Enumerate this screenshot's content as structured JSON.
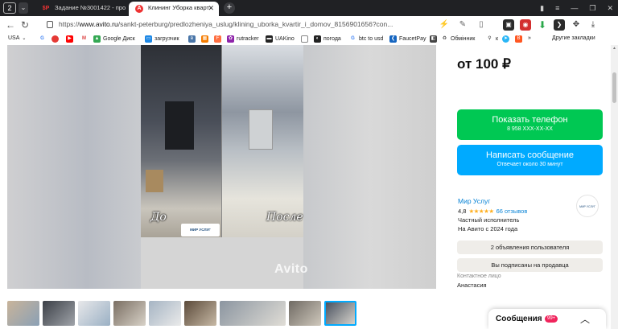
{
  "browser": {
    "tab_count": "2",
    "tabs": [
      {
        "label": "Задание №3001422 - про",
        "favicon": "$P"
      },
      {
        "label": "Клининг Уборка кварт",
        "favicon": "A"
      }
    ],
    "url_prefix": "https://",
    "url_host": "www.avito.ru",
    "url_path": "/sankt-peterburg/predlozheniya_uslug/klining_uborka_kvartir_i_domov_8156901656?con..."
  },
  "bookmarks": {
    "items": [
      "USA",
      "Google Диск",
      "загрузчик",
      "rutracker",
      "UAKino",
      "погода",
      "btc to usd",
      "FaucetPay",
      "Обмінник",
      "к"
    ],
    "other": "Другие закладки"
  },
  "gallery": {
    "label_before": "До",
    "label_after": "После",
    "logo_text": "МИР УСЛУГ",
    "watermark": "Avito"
  },
  "listing": {
    "price": "от 100 ₽",
    "phone_button": {
      "title": "Показать телефон",
      "subtitle": "8 958 XXX-XX-XX"
    },
    "message_button": {
      "title": "Написать сообщение",
      "subtitle": "Отвечает около 30 минут"
    },
    "seller": {
      "name": "Мир Услуг",
      "rating": "4,8",
      "stars": "★★★★★",
      "reviews": "66 отзывов",
      "type": "Частный исполнитель",
      "since": "На Авито с 2024 года",
      "logo_text": "МИР УСЛУГ"
    },
    "ads_button": "2 объявления пользователя",
    "subscribed_button": "Вы подписаны на продавца",
    "contact_label": "Контактное лицо",
    "contact_name": "Анастасия"
  },
  "messages": {
    "title": "Сообщения",
    "badge": "99+"
  }
}
